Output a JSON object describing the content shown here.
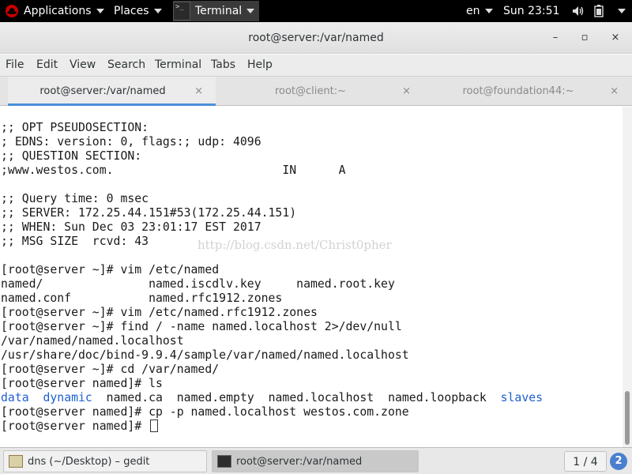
{
  "top_panel": {
    "apps_label": "Applications",
    "places_label": "Places",
    "app_label": "Terminal",
    "lang": "en",
    "clock": "Sun 23:51",
    "icons": [
      "redhat-logo-icon",
      "terminal-icon",
      "volume-icon",
      "battery-icon",
      "chevron-down-icon"
    ]
  },
  "window": {
    "title": "root@server:/var/named",
    "min_glyph": "–",
    "max_glyph": "▫",
    "close_glyph": "×"
  },
  "menu": [
    "File",
    "Edit",
    "View",
    "Search",
    "Terminal",
    "Tabs",
    "Help"
  ],
  "tabs": [
    {
      "label": "root@server:/var/named",
      "close": "×",
      "active": true
    },
    {
      "label": "root@client:~",
      "close": "×",
      "active": false
    },
    {
      "label": "root@foundation44:~",
      "close": "×",
      "active": false
    }
  ],
  "terminal": {
    "lines": [
      ";; OPT PSEUDOSECTION:",
      "; EDNS: version: 0, flags:; udp: 4096",
      ";; QUESTION SECTION:",
      ";www.westos.com.                        IN      A",
      "",
      ";; Query time: 0 msec",
      ";; SERVER: 172.25.44.151#53(172.25.44.151)",
      ";; WHEN: Sun Dec 03 23:01:17 EST 2017",
      ";; MSG SIZE  rcvd: 43",
      "",
      "[root@server ~]# vim /etc/named",
      "named/               named.iscdlv.key     named.root.key",
      "named.conf           named.rfc1912.zones",
      "[root@server ~]# vim /etc/named.rfc1912.zones",
      "[root@server ~]# find / -name named.localhost 2>/dev/null",
      "/var/named/named.localhost",
      "/usr/share/doc/bind-9.9.4/sample/var/named/named.localhost",
      "[root@server ~]# cd /var/named/",
      "[root@server named]# ls"
    ],
    "ls_output": [
      {
        "text": "data",
        "dir": true
      },
      {
        "text": "dynamic",
        "dir": true
      },
      {
        "text": "named.ca",
        "dir": false
      },
      {
        "text": "named.empty",
        "dir": false
      },
      {
        "text": "named.localhost",
        "dir": false
      },
      {
        "text": "named.loopback",
        "dir": false
      },
      {
        "text": "slaves",
        "dir": true
      }
    ],
    "after_ls": "[root@server named]# cp -p named.localhost westos.com.zone",
    "prompt": "[root@server named]# ",
    "watermark": "http://blog.csdn.net/Christ0pher",
    "dir_color": "#1f5fd0"
  },
  "taskbar": {
    "tasks": [
      {
        "label": "dns (~/Desktop) – gedit",
        "icon": "gedit-icon"
      },
      {
        "label": "root@server:/var/named",
        "icon": "terminal-icon"
      }
    ],
    "workspace": "1 / 4",
    "help_glyph": "2"
  }
}
